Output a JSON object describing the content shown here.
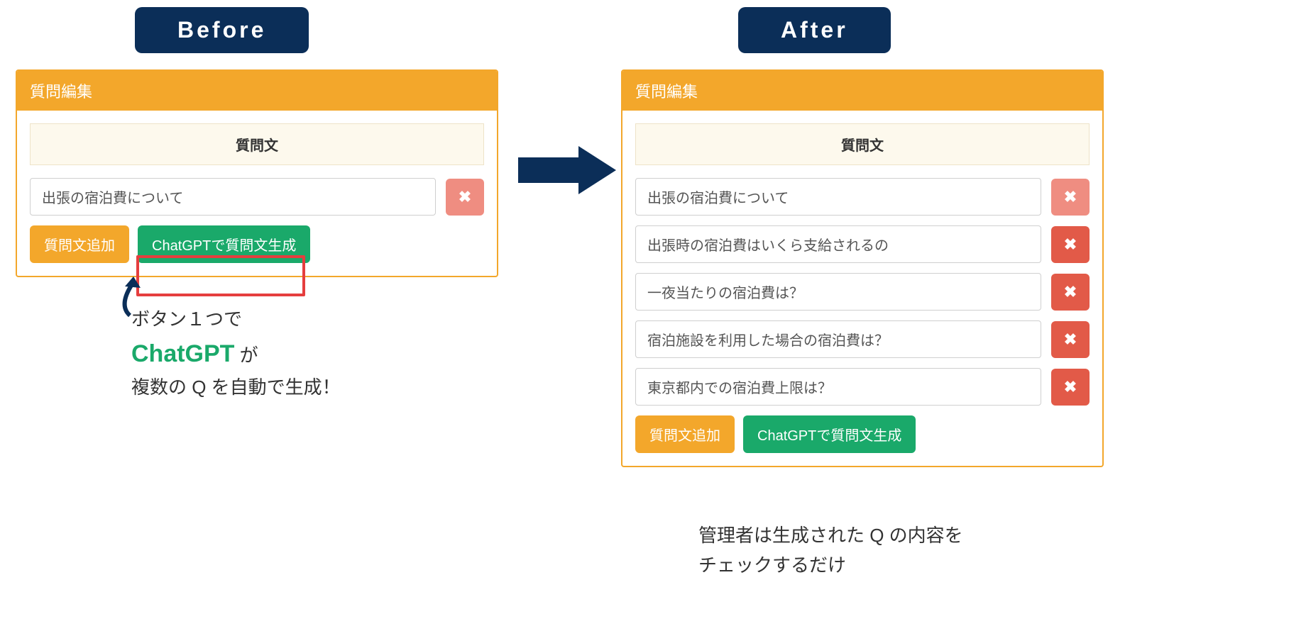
{
  "labels": {
    "before": "Before",
    "after": "After"
  },
  "before_panel": {
    "header": "質問編集",
    "column_label": "質問文",
    "questions": [
      {
        "text": "出張の宿泊費について",
        "muted": true
      }
    ],
    "add_button": "質問文追加",
    "generate_button": "ChatGPTで質問文生成"
  },
  "after_panel": {
    "header": "質問編集",
    "column_label": "質問文",
    "questions": [
      {
        "text": "出張の宿泊費について",
        "muted": true
      },
      {
        "text": "出張時の宿泊費はいくら支給されるの",
        "muted": false
      },
      {
        "text": "一夜当たりの宿泊費は？",
        "muted": false
      },
      {
        "text": "宿泊施設を利用した場合の宿泊費は？",
        "muted": false
      },
      {
        "text": "東京都内での宿泊費上限は？",
        "muted": false
      }
    ],
    "add_button": "質問文追加",
    "generate_button": "ChatGPTで質問文生成"
  },
  "captions": {
    "before_line1": "ボタン１つで",
    "before_chatgpt": "ChatGPT",
    "before_suffix": " が",
    "before_line2": "複数の Q を自動で生成！",
    "after_line1": "管理者は生成された Q の内容を",
    "after_line2": "チェックするだけ"
  },
  "icons": {
    "delete": "✖"
  }
}
